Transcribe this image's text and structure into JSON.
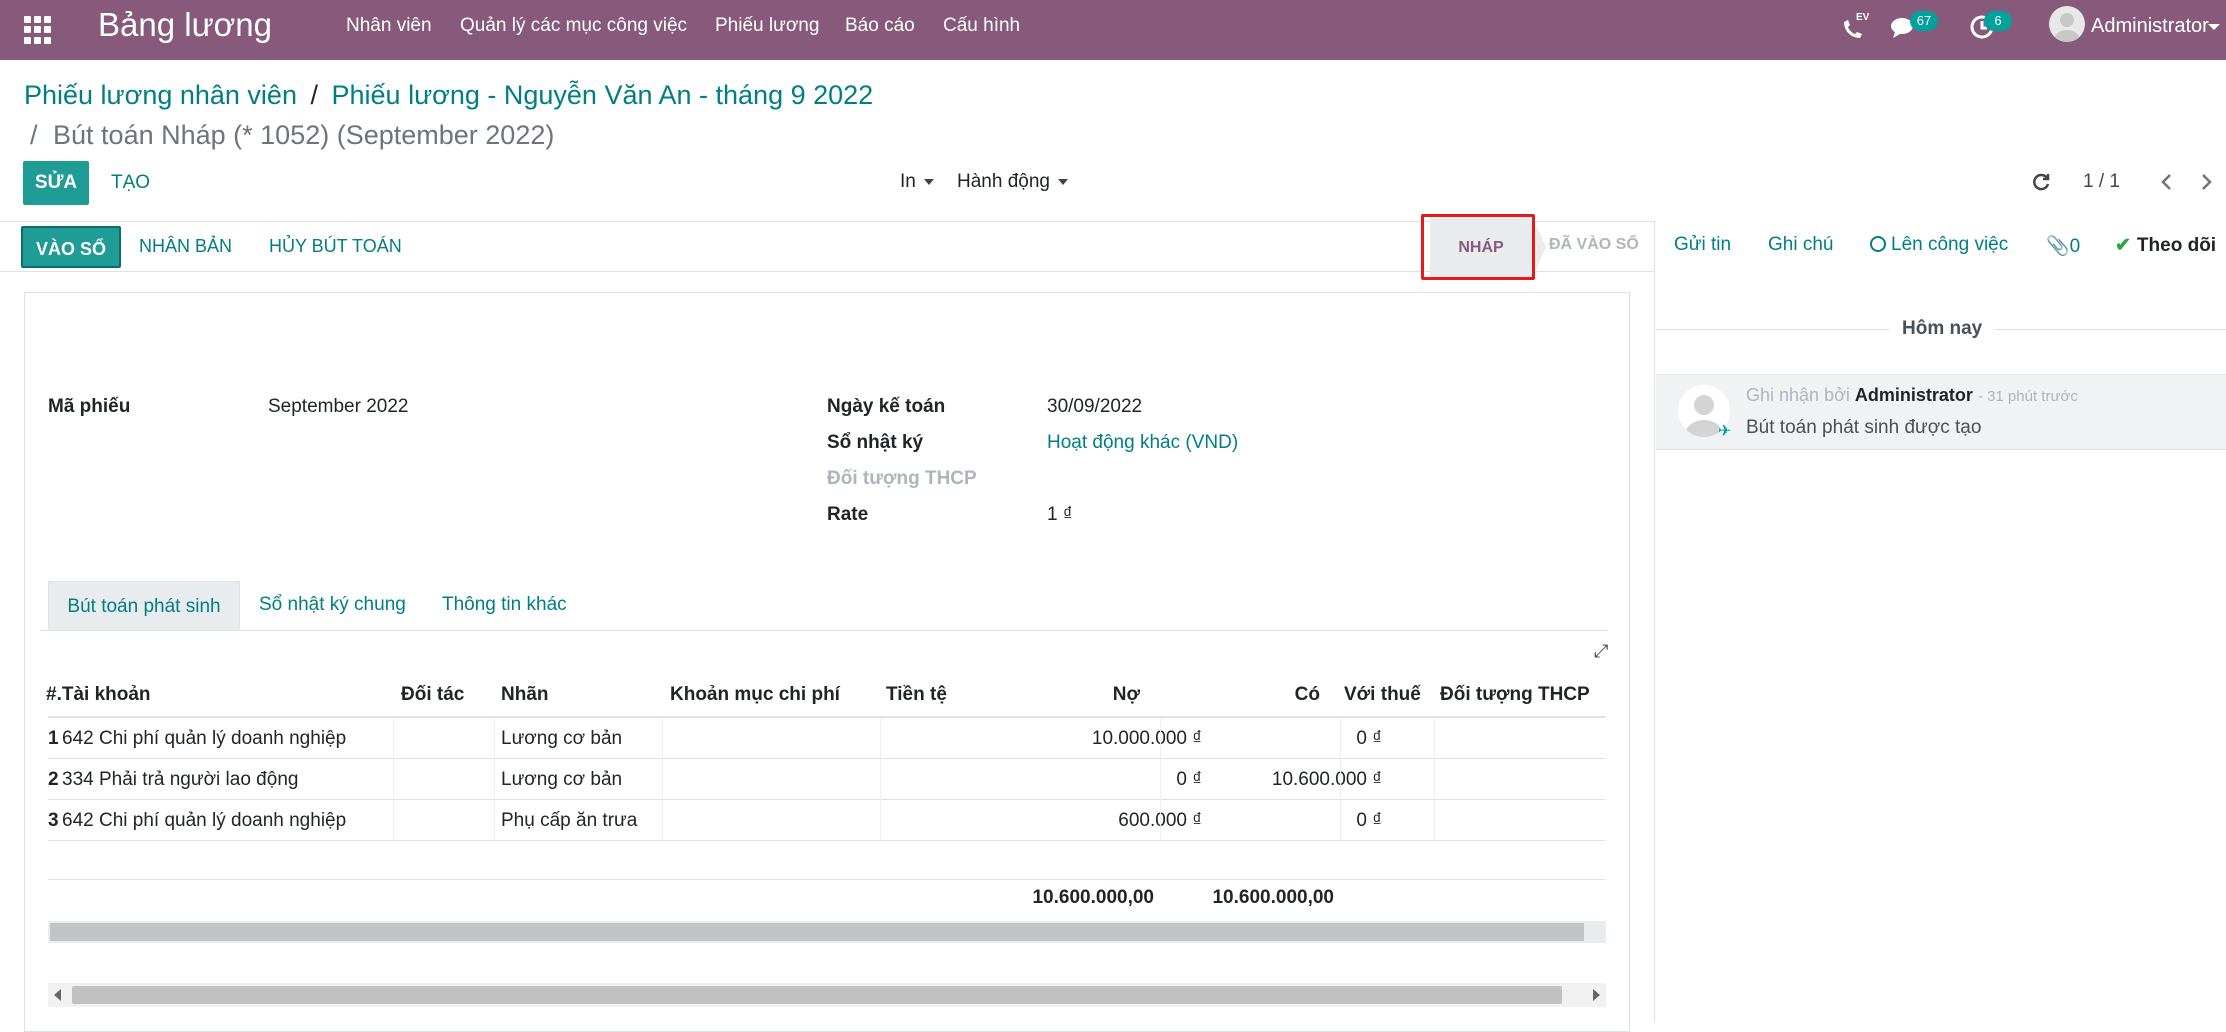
{
  "topbar": {
    "app_title": "Bảng lương",
    "menu": [
      "Nhân viên",
      "Quản lý các mục công việc",
      "Phiếu lương",
      "Báo cáo",
      "Cấu hình"
    ],
    "voip_label": "EV",
    "messages_count": "67",
    "activities_count": "6",
    "user": "Administrator"
  },
  "breadcrumb": {
    "level1": "Phiếu lương nhân viên",
    "level2": "Phiếu lương - Nguyễn Văn An - tháng 9 2022",
    "current": "Bút toán Nháp (* 1052) (September 2022)",
    "separator": "/"
  },
  "controls": {
    "edit": "SỬA",
    "create": "TẠO",
    "print": "In",
    "action": "Hành động",
    "pager": "1 / 1"
  },
  "statusbar": {
    "post": "VÀO SỔ",
    "duplicate": "NHÂN BẢN",
    "cancel": "HỦY BÚT TOÁN",
    "states": [
      "NHÁP",
      "ĐÃ VÀO SỔ"
    ]
  },
  "chatter": {
    "send": "Gửi tin",
    "note": "Ghi chú",
    "schedule": "Lên công việc",
    "attachments": "0",
    "follow": "Theo dõi",
    "today": "Hôm nay",
    "msg_prefix": "Ghi nhận bởi",
    "msg_author": "Administrator",
    "msg_time": "- 31 phút trước",
    "msg_body": "Bút toán phát sinh được tạo"
  },
  "form": {
    "ref_label": "Mã phiếu",
    "ref_value": "September 2022",
    "date_label": "Ngày kế toán",
    "date_value": "30/09/2022",
    "journal_label": "Sổ nhật ký",
    "journal_value": "Hoạt động khác (VND)",
    "analytic_label": "Đối tượng THCP",
    "rate_label": "Rate",
    "rate_value": "1 ₫"
  },
  "tabs": [
    "Bút toán phát sinh",
    "Sổ nhật ký chung",
    "Thông tin khác"
  ],
  "table": {
    "headers": [
      "#.Tài khoản",
      "Đối tác",
      "Nhãn",
      "Khoản mục chi phí",
      "Tiền tệ",
      "Nợ",
      "Có",
      "Với thuế",
      "Đối tượng THCP"
    ],
    "rows": [
      {
        "no": "1",
        "account": "642 Chi phí quản lý doanh nghiệp",
        "label": "Lương cơ bản",
        "debit": "10.000.000 ₫",
        "credit": "0 ₫"
      },
      {
        "no": "2",
        "account": "334 Phải trả người lao động",
        "label": "Lương cơ bản",
        "debit": "0 ₫",
        "credit": "10.600.000 ₫"
      },
      {
        "no": "3",
        "account": "642 Chi phí quản lý doanh nghiệp",
        "label": "Phụ cấp ăn trưa",
        "debit": "600.000 ₫",
        "credit": "0 ₫"
      }
    ],
    "total_debit": "10.600.000,00",
    "total_credit": "10.600.000,00"
  },
  "colors": {
    "topbar": "#875a7b",
    "primary": "#1f9c95",
    "link": "#017e84",
    "highlight": "#e31b1b"
  }
}
